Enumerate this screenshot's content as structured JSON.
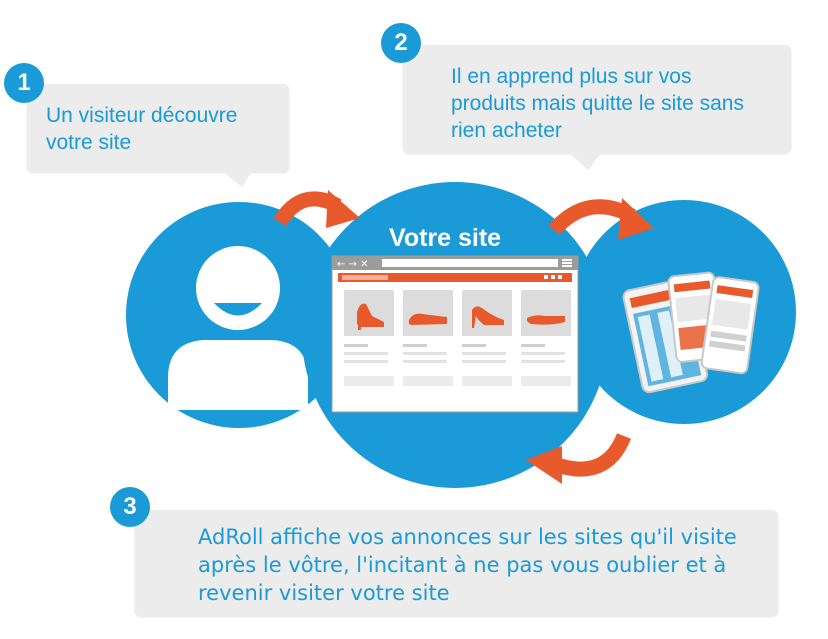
{
  "steps": [
    {
      "number": "1",
      "text": "Un visiteur découvre votre site"
    },
    {
      "number": "2",
      "text": "Il en apprend plus sur vos produits mais quitte le site sans rien acheter"
    },
    {
      "number": "3",
      "text": "AdRoll affiche vos annonces sur les sites qu'il visite après le vôtre, l'incitant à ne pas vous oublier et à revenir visiter votre site"
    }
  ],
  "site_title": "Votre site",
  "icons": {
    "visitor": "user-silhouette-icon",
    "website": "browser-window-icon",
    "products": "shoe-icon",
    "ads": "mobile-ads-icon",
    "flow": "curved-arrow-icon"
  },
  "colors": {
    "primary_blue": "#1a9ad6",
    "accent_orange": "#e85a2c",
    "bubble_gray": "#ececec"
  }
}
